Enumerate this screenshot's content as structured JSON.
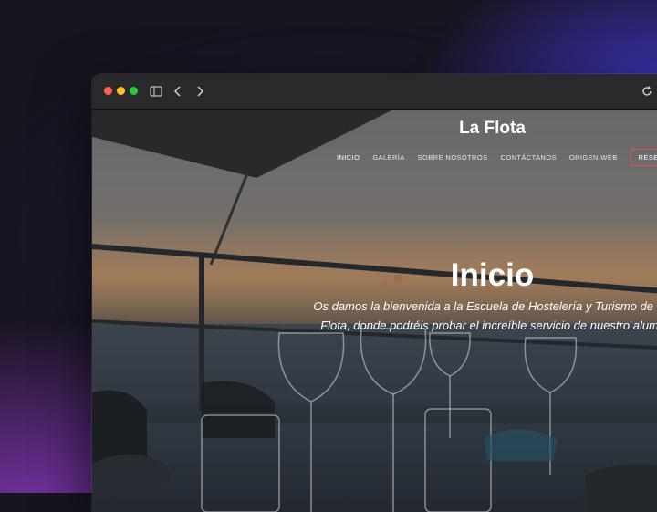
{
  "browser": {
    "icons": [
      "sidebar-icon",
      "chevron-left-icon",
      "chevron-right-icon",
      "reload-icon"
    ]
  },
  "site": {
    "title": "La Flota",
    "nav": {
      "items": [
        "INICIO",
        "GALERÍA",
        "SOBRE NOSOTROS",
        "CONTÁCTANOS",
        "ORIGEN WEB"
      ],
      "active": "INICIO",
      "reserve_label": "RESERVAR"
    }
  },
  "hero": {
    "title": "Inicio",
    "line1": "Os damos la bienvenida a la Escuela de Hostelería y Turismo de Murcia",
    "line2": "Flota, donde podréis probar el increíble servicio de nuestro alumnado"
  },
  "colors": {
    "accent": "#d9534f",
    "traffic_red": "#fe5f57",
    "traffic_yellow": "#febc2e",
    "traffic_green": "#28c840"
  }
}
